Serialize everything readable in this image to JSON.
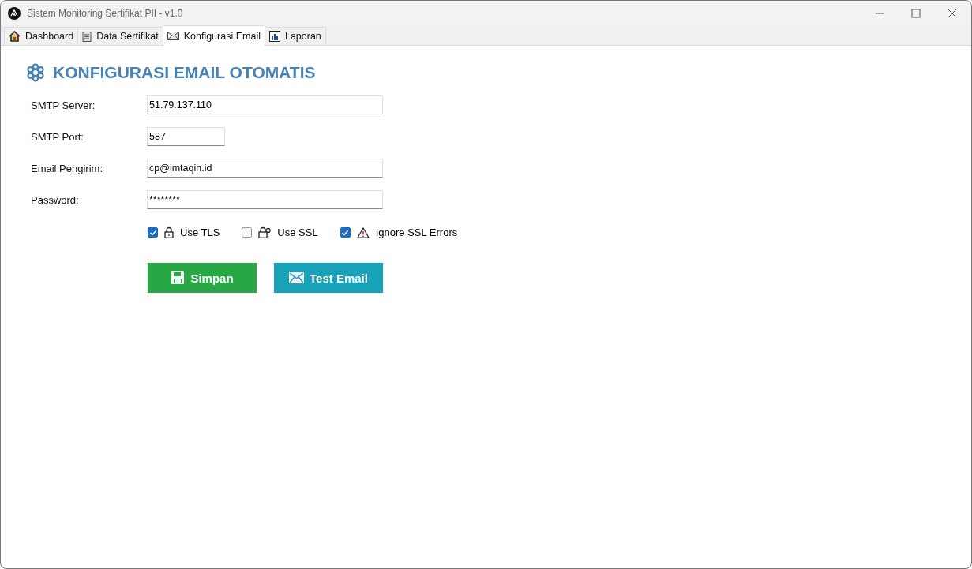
{
  "window": {
    "title": "Sistem Monitoring Sertifikat PII - v1.0"
  },
  "tabs": [
    {
      "label": "Dashboard",
      "selected": false
    },
    {
      "label": "Data Sertifikat",
      "selected": false
    },
    {
      "label": "Konfigurasi Email",
      "selected": true
    },
    {
      "label": "Laporan",
      "selected": false
    }
  ],
  "heading": "KONFIGURASI EMAIL OTOMATIS",
  "fields": [
    {
      "label": "SMTP Server:",
      "value": "51.79.137.110",
      "short": false
    },
    {
      "label": "SMTP Port:",
      "value": "587",
      "short": true
    },
    {
      "label": "Email Pengirim:",
      "value": "cp@imtaqin.id",
      "short": false
    },
    {
      "label": "Password:",
      "value": "********",
      "short": false
    }
  ],
  "options": [
    {
      "label": "Use TLS",
      "checked": true
    },
    {
      "label": "Use SSL",
      "checked": false
    },
    {
      "label": "Ignore SSL Errors",
      "checked": true
    }
  ],
  "buttons": [
    {
      "label": "Simpan",
      "kind": "save"
    },
    {
      "label": "Test Email",
      "kind": "test"
    }
  ]
}
